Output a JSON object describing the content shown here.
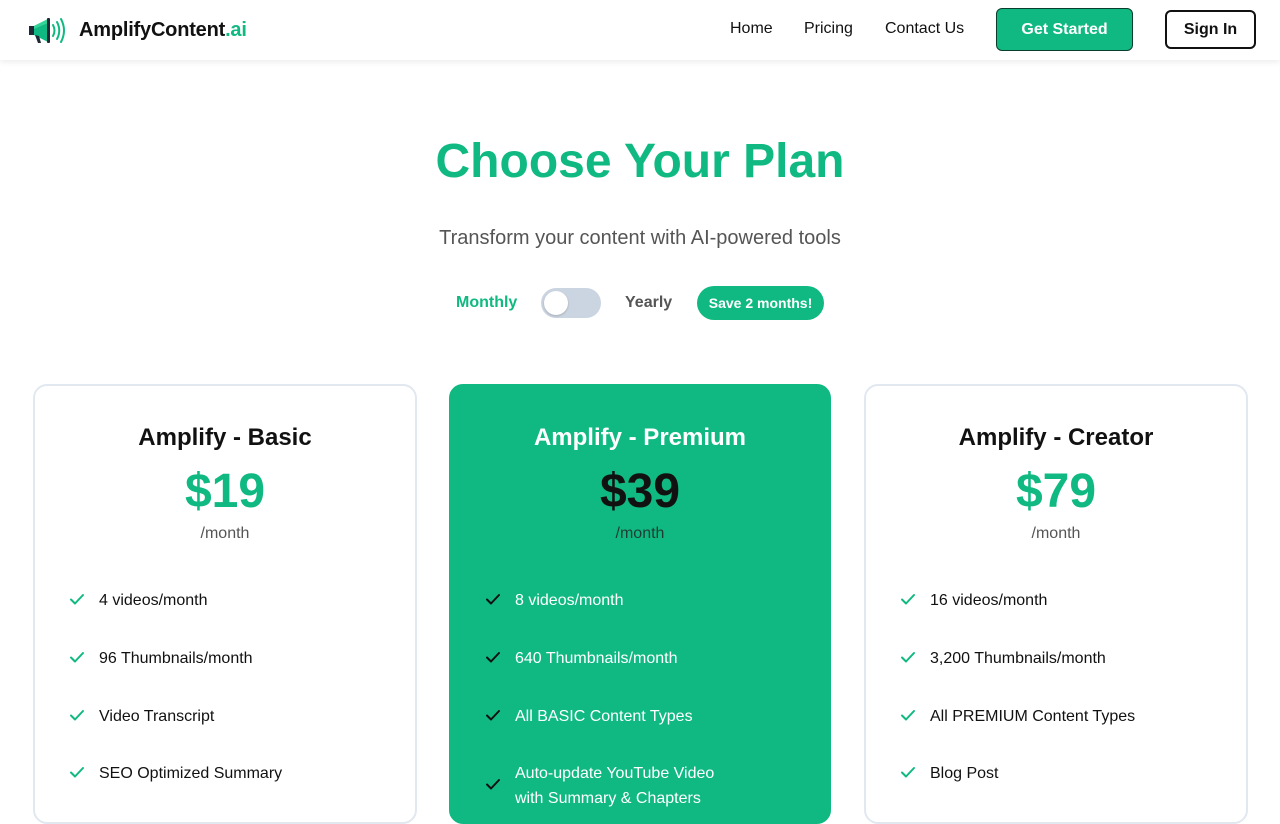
{
  "brand": {
    "name": "AmplifyContent",
    "suffix": ".ai",
    "accent_color": "#10b981",
    "logo_icon": "megaphone-icon"
  },
  "nav": {
    "links": [
      "Home",
      "Pricing",
      "Contact Us"
    ],
    "get_started": "Get Started",
    "sign_in": "Sign In"
  },
  "hero": {
    "title": "Choose Your Plan",
    "subtitle": "Transform your content with AI-powered tools"
  },
  "billing": {
    "monthly_label": "Monthly",
    "yearly_label": "Yearly",
    "badge": "Save 2 months!",
    "selected": "Monthly"
  },
  "plans": [
    {
      "name": "Amplify - Basic",
      "price": "$19",
      "period": "/month",
      "featured": false,
      "features": [
        "4 videos/month",
        "96 Thumbnails/month",
        "Video Transcript",
        "SEO Optimized Summary"
      ]
    },
    {
      "name": "Amplify - Premium",
      "price": "$39",
      "period": "/month",
      "featured": true,
      "features": [
        "8 videos/month",
        "640 Thumbnails/month",
        "All BASIC Content Types",
        "Auto-update YouTube Video with Summary & Chapters"
      ]
    },
    {
      "name": "Amplify - Creator",
      "price": "$79",
      "period": "/month",
      "featured": false,
      "features": [
        "16 videos/month",
        "3,200 Thumbnails/month",
        "All PREMIUM Content Types",
        "Blog Post"
      ]
    }
  ],
  "colors": {
    "accent": "#10b981",
    "toggle_track": "#cbd5e1",
    "card_border": "#e2e8f0"
  },
  "icons": {
    "feature": "check-icon"
  }
}
